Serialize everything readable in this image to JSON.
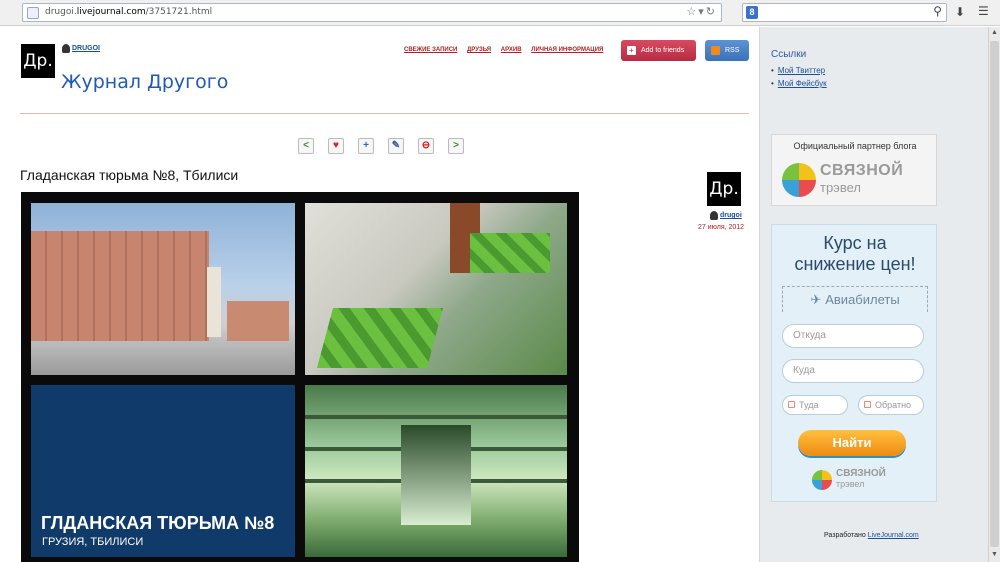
{
  "browser": {
    "url_prefix": "drugoi.",
    "url_domain": "livejournal.com",
    "url_path": "/3751721.html",
    "search_engine_letter": "8"
  },
  "header": {
    "logo_text": "Др.",
    "username": "DRUGOI",
    "journal_title": "Журнал Другого",
    "nav": [
      "Свежие записи",
      "Друзья",
      "Архив",
      "Личная информация"
    ],
    "add_friends_label": "Add to friends",
    "rss_label": "RSS"
  },
  "post": {
    "title": "Гладанская тюрьма №8, Тбилиси",
    "image_caption_line1": "ГЛДАНСКАЯ ТЮРЬМА №8",
    "image_caption_line2": "ГРУЗИЯ, ТБИЛИСИ",
    "author_logo": "Др.",
    "author_name": "drugoi",
    "date": "27 июля, 2012"
  },
  "toolbar": {
    "prev_icon": "arrow-left-icon",
    "heart_icon": "heart-icon",
    "add_icon": "plus-icon",
    "tool_icon": "tool-icon",
    "stop_icon": "stop-icon",
    "next_icon": "arrow-right-icon"
  },
  "sidebar": {
    "links_title": "Ссылки",
    "links": [
      "Мой Твиттер",
      "Мой Фейсбук"
    ],
    "partner_title": "Официальный партнер блога",
    "partner_brand": "СВЯЗНОЙ",
    "partner_sub": "трэвел",
    "ad": {
      "title_line1": "Курс на",
      "title_line2": "снижение цен!",
      "tab_label": "Авиабилеты",
      "from_placeholder": "Откуда",
      "to_placeholder": "Куда",
      "date_there": "Туда",
      "date_back": "Обратно",
      "button_label": "Найти",
      "brand": "СВЯЗНОЙ",
      "brand_sub": "трэвел"
    },
    "powered_by_prefix": "Разработано",
    "powered_by_link": "LiveJournal.com"
  }
}
